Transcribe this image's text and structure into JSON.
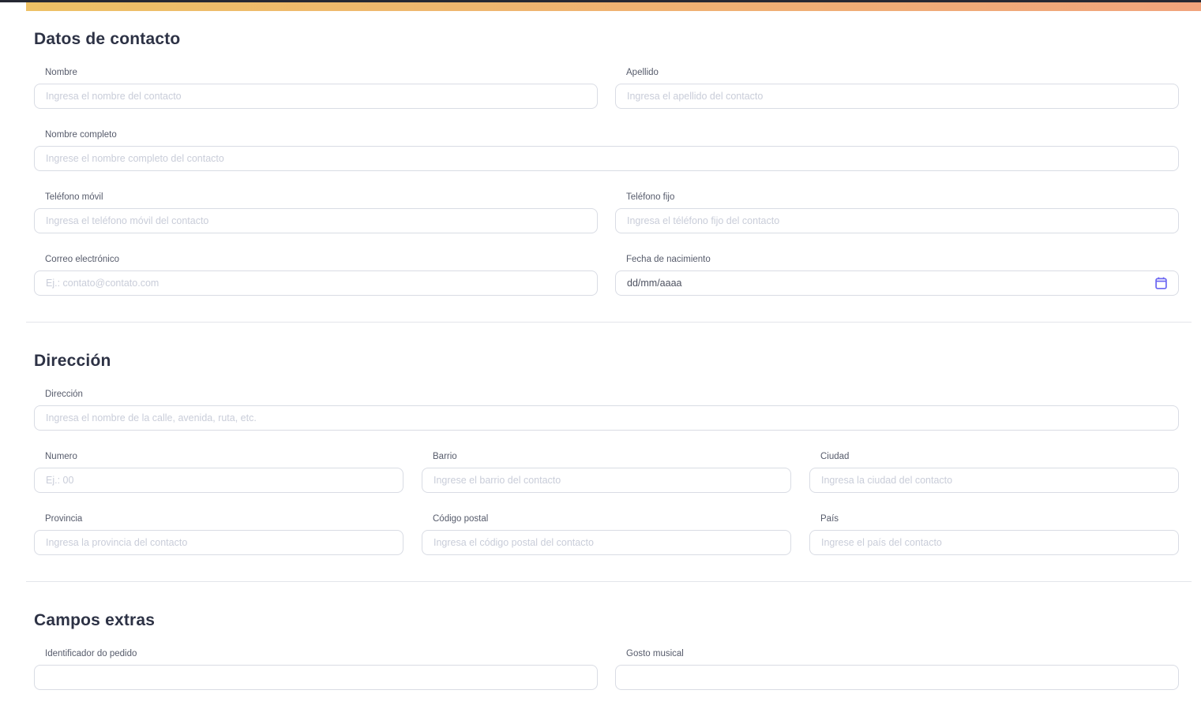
{
  "theme": {
    "topbar_gradient_from": "#eec166",
    "topbar_gradient_to": "#f1a47d",
    "top_line_color": "#262833",
    "accent_color": "#6b66f2",
    "heading_color": "#2d3245"
  },
  "sections": {
    "contact": {
      "title": "Datos de contacto",
      "fields": {
        "nombre": {
          "label": "Nombre",
          "placeholder": "Ingresa el nombre del contacto"
        },
        "apellido": {
          "label": "Apellido",
          "placeholder": "Ingresa el apellido del contacto"
        },
        "nombre_completo": {
          "label": "Nombre completo",
          "placeholder": "Ingrese el nombre completo del contacto"
        },
        "telefono_movil": {
          "label": "Teléfono móvil",
          "placeholder": "Ingresa el teléfono móvil del contacto"
        },
        "telefono_fijo": {
          "label": "Teléfono fijo",
          "placeholder": "Ingresa el téléfono fijo del contacto"
        },
        "correo": {
          "label": "Correo electrónico",
          "placeholder": "Ej.: contato@contato.com"
        },
        "fecha_nacimiento": {
          "label": "Fecha de nacimiento",
          "value": "dd/mm/aaaa",
          "icon": "calendar-icon"
        }
      }
    },
    "address": {
      "title": "Dirección",
      "fields": {
        "direccion": {
          "label": "Dirección",
          "placeholder": "Ingresa el nombre de la calle, avenida, ruta, etc."
        },
        "numero": {
          "label": "Numero",
          "placeholder": "Ej.: 00"
        },
        "barrio": {
          "label": "Barrio",
          "placeholder": "Ingrese el barrio del contacto"
        },
        "ciudad": {
          "label": "Ciudad",
          "placeholder": "Ingresa la ciudad del contacto"
        },
        "provincia": {
          "label": "Provincia",
          "placeholder": "Ingresa la provincia del contacto"
        },
        "codigo_postal": {
          "label": "Código postal",
          "placeholder": "Ingresa el código postal del contacto"
        },
        "pais": {
          "label": "País",
          "placeholder": "Ingrese el país del contacto"
        }
      }
    },
    "extras": {
      "title": "Campos extras",
      "fields": {
        "identificador_pedido": {
          "label": "Identificador do pedido",
          "placeholder": ""
        },
        "gosto_musical": {
          "label": "Gosto musical",
          "placeholder": ""
        }
      }
    }
  }
}
